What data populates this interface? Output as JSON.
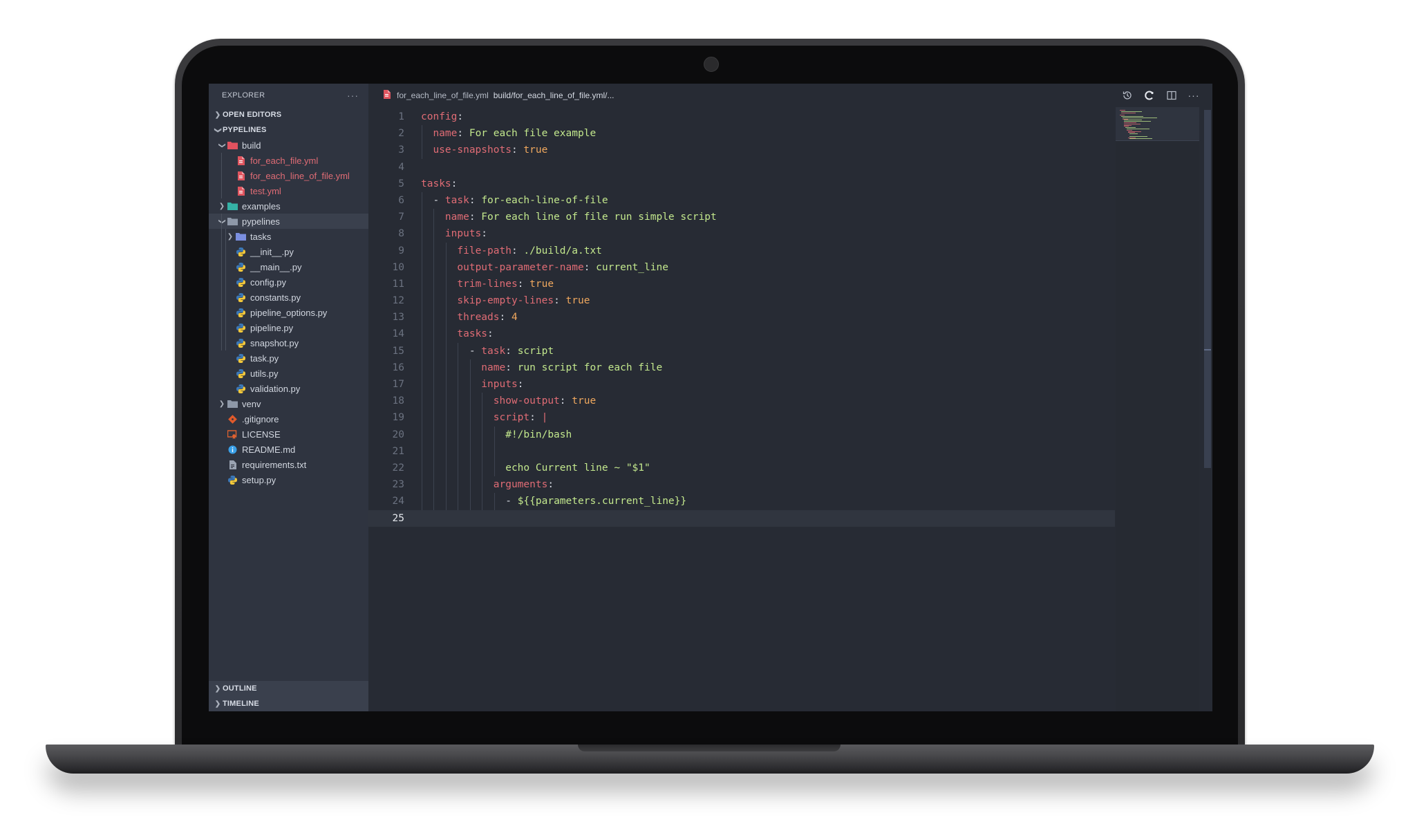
{
  "sidebar": {
    "title": "EXPLORER",
    "more": "···",
    "open_editors": "OPEN EDITORS",
    "workspace": "PYPELINES",
    "outline": "OUTLINE",
    "timeline": "TIMELINE",
    "tree": [
      {
        "label": "build",
        "icon": "folder-icon",
        "open": true
      },
      {
        "label": "for_each_file.yml",
        "icon": "yaml-file-icon"
      },
      {
        "label": "for_each_line_of_file.yml",
        "icon": "yaml-file-icon"
      },
      {
        "label": "test.yml",
        "icon": "yaml-file-icon"
      },
      {
        "label": "examples",
        "icon": "folder-icon",
        "open": false
      },
      {
        "label": "pypelines",
        "icon": "folder-icon",
        "open": true
      },
      {
        "label": "tasks",
        "icon": "folder-icon",
        "open": false
      },
      {
        "label": "__init__.py",
        "icon": "python-file-icon"
      },
      {
        "label": "__main__.py",
        "icon": "python-file-icon"
      },
      {
        "label": "config.py",
        "icon": "python-file-icon"
      },
      {
        "label": "constants.py",
        "icon": "python-file-icon"
      },
      {
        "label": "pipeline_options.py",
        "icon": "python-file-icon"
      },
      {
        "label": "pipeline.py",
        "icon": "python-file-icon"
      },
      {
        "label": "snapshot.py",
        "icon": "python-file-icon"
      },
      {
        "label": "task.py",
        "icon": "python-file-icon"
      },
      {
        "label": "utils.py",
        "icon": "python-file-icon"
      },
      {
        "label": "validation.py",
        "icon": "python-file-icon"
      },
      {
        "label": "venv",
        "icon": "folder-icon",
        "open": false
      },
      {
        "label": ".gitignore",
        "icon": "git-icon"
      },
      {
        "label": "LICENSE",
        "icon": "license-icon"
      },
      {
        "label": "README.md",
        "icon": "info-icon"
      },
      {
        "label": "requirements.txt",
        "icon": "text-file-icon"
      },
      {
        "label": "setup.py",
        "icon": "python-file-icon"
      }
    ]
  },
  "editor": {
    "tab_name": "for_each_line_of_file.yml",
    "tab_path": "build/for_each_line_of_file.yml/...",
    "current_line": 25,
    "lines": [
      {
        "n": "1",
        "parts": [
          [
            "k",
            "config"
          ],
          [
            "p",
            ":"
          ]
        ]
      },
      {
        "n": "2",
        "parts": [
          [
            "k",
            "name"
          ],
          [
            "p",
            ": "
          ],
          [
            "v",
            "For each file example"
          ]
        ]
      },
      {
        "n": "3",
        "parts": [
          [
            "k",
            "use-snapshots"
          ],
          [
            "p",
            ": "
          ],
          [
            "b",
            "true"
          ]
        ]
      },
      {
        "n": "4",
        "parts": []
      },
      {
        "n": "5",
        "parts": [
          [
            "k",
            "tasks"
          ],
          [
            "p",
            ":"
          ]
        ]
      },
      {
        "n": "6",
        "parts": [
          [
            "p",
            "- "
          ],
          [
            "k",
            "task"
          ],
          [
            "p",
            ": "
          ],
          [
            "v",
            "for-each-line-of-file"
          ]
        ]
      },
      {
        "n": "7",
        "parts": [
          [
            "k",
            "name"
          ],
          [
            "p",
            ": "
          ],
          [
            "v",
            "For each line of file run simple script"
          ]
        ]
      },
      {
        "n": "8",
        "parts": [
          [
            "k",
            "inputs"
          ],
          [
            "p",
            ":"
          ]
        ]
      },
      {
        "n": "9",
        "parts": [
          [
            "k",
            "file-path"
          ],
          [
            "p",
            ": "
          ],
          [
            "v",
            "./build/a.txt"
          ]
        ]
      },
      {
        "n": "10",
        "parts": [
          [
            "k",
            "output-parameter-name"
          ],
          [
            "p",
            ": "
          ],
          [
            "v",
            "current_line"
          ]
        ]
      },
      {
        "n": "11",
        "parts": [
          [
            "k",
            "trim-lines"
          ],
          [
            "p",
            ": "
          ],
          [
            "b",
            "true"
          ]
        ]
      },
      {
        "n": "12",
        "parts": [
          [
            "k",
            "skip-empty-lines"
          ],
          [
            "p",
            ": "
          ],
          [
            "b",
            "true"
          ]
        ]
      },
      {
        "n": "13",
        "parts": [
          [
            "k",
            "threads"
          ],
          [
            "p",
            ": "
          ],
          [
            "b",
            "4"
          ]
        ]
      },
      {
        "n": "14",
        "parts": [
          [
            "k",
            "tasks"
          ],
          [
            "p",
            ":"
          ]
        ]
      },
      {
        "n": "15",
        "parts": [
          [
            "p",
            "- "
          ],
          [
            "k",
            "task"
          ],
          [
            "p",
            ": "
          ],
          [
            "v",
            "script"
          ]
        ]
      },
      {
        "n": "16",
        "parts": [
          [
            "k",
            "name"
          ],
          [
            "p",
            ": "
          ],
          [
            "v",
            "run script for each file"
          ]
        ]
      },
      {
        "n": "17",
        "parts": [
          [
            "k",
            "inputs"
          ],
          [
            "p",
            ":"
          ]
        ]
      },
      {
        "n": "18",
        "parts": [
          [
            "k",
            "show-output"
          ],
          [
            "p",
            ": "
          ],
          [
            "b",
            "true"
          ]
        ]
      },
      {
        "n": "19",
        "parts": [
          [
            "k",
            "script"
          ],
          [
            "p",
            ": "
          ],
          [
            "k",
            "|"
          ]
        ]
      },
      {
        "n": "20",
        "parts": [
          [
            "v",
            "#!/bin/bash"
          ]
        ]
      },
      {
        "n": "21",
        "parts": []
      },
      {
        "n": "22",
        "parts": [
          [
            "v",
            "echo Current line ~ \"$1\""
          ]
        ]
      },
      {
        "n": "23",
        "parts": [
          [
            "k",
            "arguments"
          ],
          [
            "p",
            ":"
          ]
        ]
      },
      {
        "n": "24",
        "parts": [
          [
            "p",
            "- "
          ],
          [
            "v",
            "${{parameters.current_line}}"
          ]
        ]
      },
      {
        "n": "25",
        "parts": []
      }
    ]
  },
  "colors": {
    "key": "#e06c75",
    "string": "#c3e88d",
    "literal": "#f0a85e",
    "background": "#272b34",
    "sidebar": "#2f3440"
  }
}
